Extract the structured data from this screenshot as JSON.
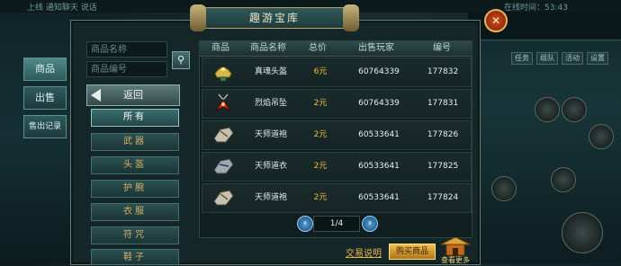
{
  "window": {
    "title": "趣游宝库"
  },
  "game_bg": {
    "top_left_text_1": "上线  通知聊天  说话",
    "top_right_text": "在线时间：53:43",
    "right_tabs": [
      "任务",
      "组队",
      "活动",
      "设置"
    ],
    "skill_labels": [
      "",
      "",
      "",
      "",
      "",
      ""
    ]
  },
  "side_tabs": {
    "goods": "商品",
    "sell": "出售",
    "sold_records": "售出记录"
  },
  "search": {
    "name_placeholder": "商品名称",
    "id_placeholder": "商品编号"
  },
  "back_label": "返回",
  "categories": [
    "所有",
    "武器",
    "头盔",
    "护腕",
    "衣服",
    "符咒",
    "鞋子"
  ],
  "table": {
    "headers": [
      "商品",
      "商品名称",
      "总价",
      "出售玩家",
      "编号"
    ],
    "rows": [
      {
        "icon": "helmet-icon",
        "name": "真魂头盔",
        "price": "6元",
        "seller": "60764339",
        "id": "177832"
      },
      {
        "icon": "pendant-icon",
        "name": "烈焰吊坠",
        "price": "2元",
        "seller": "60764339",
        "id": "177831"
      },
      {
        "icon": "robe-icon",
        "name": "天师道袍",
        "price": "2元",
        "seller": "60533641",
        "id": "177826"
      },
      {
        "icon": "clothes-icon",
        "name": "天师道衣",
        "price": "2元",
        "seller": "60533641",
        "id": "177825"
      },
      {
        "icon": "robe-icon",
        "name": "天师道袍",
        "price": "2元",
        "seller": "60533641",
        "id": "177824"
      }
    ]
  },
  "pagination": {
    "text": "1/4"
  },
  "footer": {
    "help": "交易说明",
    "buy": "购买商品",
    "more": "查看更多"
  },
  "colors": {
    "price": "#f0c13c",
    "accent_gold": "#b8a36a"
  }
}
